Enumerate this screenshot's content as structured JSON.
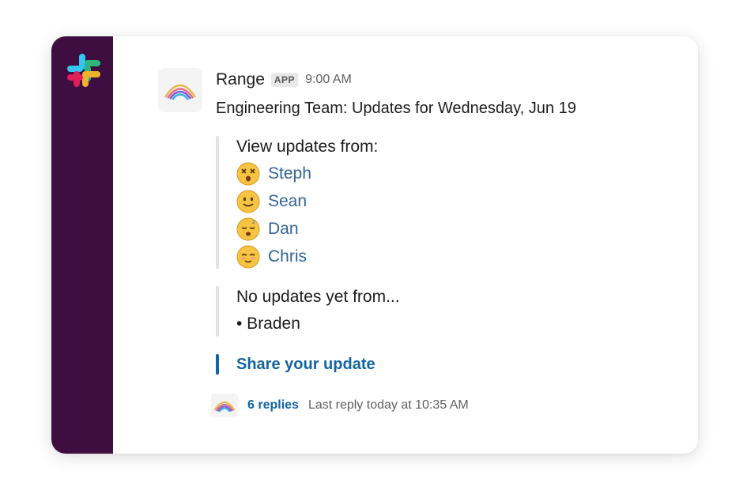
{
  "message": {
    "sender": "Range",
    "badge": "APP",
    "time": "9:00 AM",
    "title": "Engineering Team: Updates for Wednesday, Jun 19"
  },
  "updates": {
    "heading": "View updates from:",
    "people": [
      {
        "name": "Steph",
        "emoji": "dizzy-face-icon"
      },
      {
        "name": "Sean",
        "emoji": "slightly-smiling-face-icon"
      },
      {
        "name": "Dan",
        "emoji": "sleeping-face-icon"
      },
      {
        "name": "Chris",
        "emoji": "relieved-face-icon"
      }
    ]
  },
  "pending": {
    "heading": "No updates yet from...",
    "people": [
      "• Braden"
    ]
  },
  "action": {
    "share_label": "Share your update"
  },
  "thread": {
    "replies": "6 replies",
    "last_reply": "Last reply today at 10:35 AM"
  },
  "colors": {
    "sidebar": "#3f0e40",
    "link": "#1264a3",
    "person_link": "#2f6496",
    "accent_bar": "#1264a3"
  }
}
